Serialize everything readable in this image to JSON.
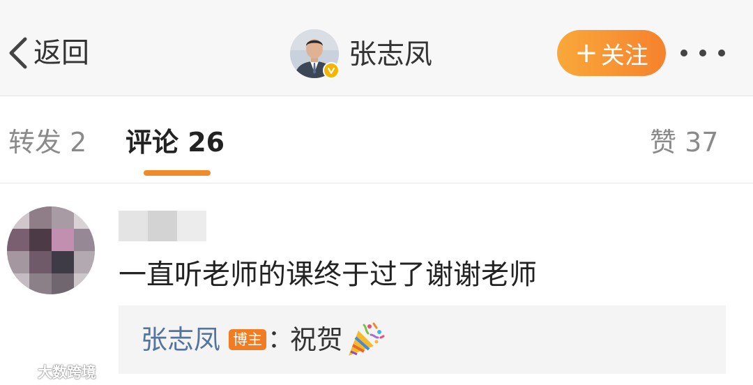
{
  "header": {
    "back_label": "返回",
    "username": "张志凤",
    "follow_label": "关注",
    "follow_plus": "+",
    "colors": {
      "follow_button": "#f6822d",
      "verify_badge": "#f4b400"
    }
  },
  "tabs": {
    "repost": "转发 2",
    "comments": "评论 26",
    "likes": "赞 37",
    "active_color": "#f08a2b"
  },
  "comment": {
    "text": "一直听老师的课终于过了谢谢老师",
    "reply": {
      "author": "张志凤",
      "tag": "博主",
      "separator": "：",
      "text": "祝贺",
      "emoji_icon": "party-popper-icon",
      "author_color": "#52749e"
    }
  },
  "watermark": {
    "text": "大数跨境"
  }
}
